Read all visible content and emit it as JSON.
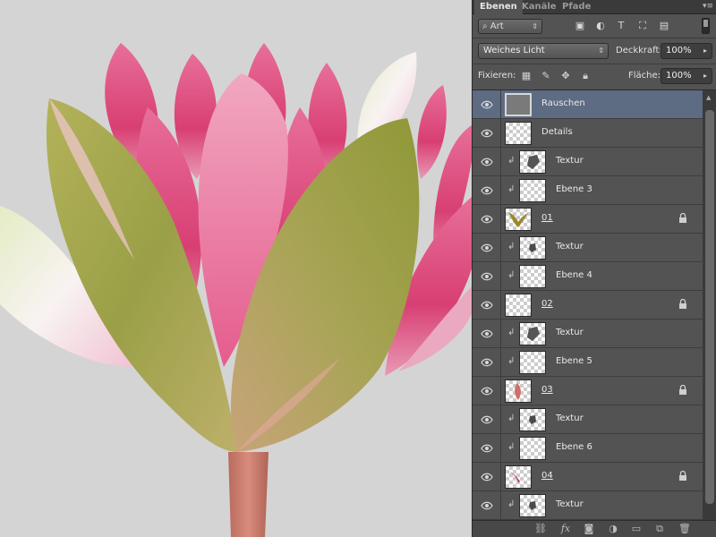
{
  "panel": {
    "tabs": [
      {
        "label": "Ebenen",
        "active": true
      },
      {
        "label": "Kanäle",
        "active": false
      },
      {
        "label": "Pfade",
        "active": false
      }
    ],
    "menu_icon": "panel-menu-icon"
  },
  "filter": {
    "kind_label": "Art",
    "search_icon": "search-icon",
    "filter_icons": [
      "image-filter-icon",
      "adjustment-filter-icon",
      "type-filter-icon",
      "shape-filter-icon",
      "smart-object-filter-icon"
    ]
  },
  "blend": {
    "mode": "Weiches Licht",
    "opacity_label": "Deckkraft:",
    "opacity_value": "100%",
    "lock_label": "Fixieren:",
    "fill_label": "Fläche:",
    "fill_value": "100%",
    "lock_icons": [
      "lock-transparent-icon",
      "lock-paint-icon",
      "lock-move-icon",
      "lock-all-icon"
    ]
  },
  "layers": [
    {
      "name": "Rauschen",
      "clipped": false,
      "locked": false,
      "selected": true,
      "thumb": "gray",
      "underline": false
    },
    {
      "name": "Details",
      "clipped": false,
      "locked": false,
      "selected": false,
      "thumb": "empty",
      "underline": false
    },
    {
      "name": "Textur",
      "clipped": true,
      "locked": false,
      "selected": false,
      "thumb": "stone",
      "underline": false
    },
    {
      "name": "Ebene 3",
      "clipped": true,
      "locked": false,
      "selected": false,
      "thumb": "empty",
      "underline": false
    },
    {
      "name": "01",
      "clipped": false,
      "locked": true,
      "selected": false,
      "thumb": "petal-green",
      "underline": true
    },
    {
      "name": "Textur",
      "clipped": true,
      "locked": false,
      "selected": false,
      "thumb": "stone-small",
      "underline": false
    },
    {
      "name": "Ebene 4",
      "clipped": true,
      "locked": false,
      "selected": false,
      "thumb": "empty",
      "underline": false
    },
    {
      "name": "02",
      "clipped": false,
      "locked": true,
      "selected": false,
      "thumb": "empty",
      "underline": true
    },
    {
      "name": "Textur",
      "clipped": true,
      "locked": false,
      "selected": false,
      "thumb": "stone",
      "underline": false
    },
    {
      "name": "Ebene 5",
      "clipped": true,
      "locked": false,
      "selected": false,
      "thumb": "empty",
      "underline": false
    },
    {
      "name": "03",
      "clipped": false,
      "locked": true,
      "selected": false,
      "thumb": "petal-pink",
      "underline": true
    },
    {
      "name": "Textur",
      "clipped": true,
      "locked": false,
      "selected": false,
      "thumb": "stone-small",
      "underline": false
    },
    {
      "name": "Ebene 6",
      "clipped": true,
      "locked": false,
      "selected": false,
      "thumb": "empty",
      "underline": false
    },
    {
      "name": "04",
      "clipped": false,
      "locked": true,
      "selected": false,
      "thumb": "petal-red",
      "underline": true
    },
    {
      "name": "Textur",
      "clipped": true,
      "locked": false,
      "selected": false,
      "thumb": "stone-small",
      "underline": false
    }
  ],
  "bottom_icons": [
    "link-layers-icon",
    "fx-icon",
    "add-mask-icon",
    "adjustment-layer-icon",
    "new-group-icon",
    "new-layer-icon",
    "delete-layer-icon"
  ],
  "colors": {
    "canvas_bg": "#d4d4d4",
    "panel_bg": "#535353",
    "selected_layer": "#5d6b83",
    "petal_pink": "#e0467d",
    "petal_green": "#9aa04a"
  }
}
